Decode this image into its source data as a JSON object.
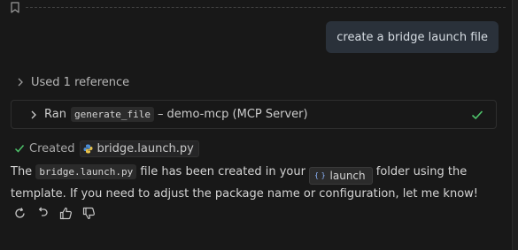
{
  "user_message": "create a bridge launch file",
  "references": {
    "label": "Used 1 reference"
  },
  "tool_call": {
    "prefix": "Ran",
    "tool_name": "generate_file",
    "separator": "–",
    "server": "demo-mcp (MCP Server)"
  },
  "created": {
    "label": "Created",
    "file": "bridge.launch.py"
  },
  "response": {
    "part1": "The ",
    "file_code": "bridge.launch.py",
    "part2": " file has been created in your ",
    "folder_label": "launch",
    "folder_icon": "{ }",
    "part3": " folder using the template. If you need to adjust the package name or configuration, let me know!"
  },
  "actions": [
    {
      "name": "retry-icon"
    },
    {
      "name": "undo-icon"
    },
    {
      "name": "thumbs-up-icon"
    },
    {
      "name": "thumbs-down-icon"
    }
  ],
  "colors": {
    "background": "#181818",
    "bubble": "#2a313a",
    "success": "#4ec36b",
    "python_icon": "#4d8fd8"
  }
}
